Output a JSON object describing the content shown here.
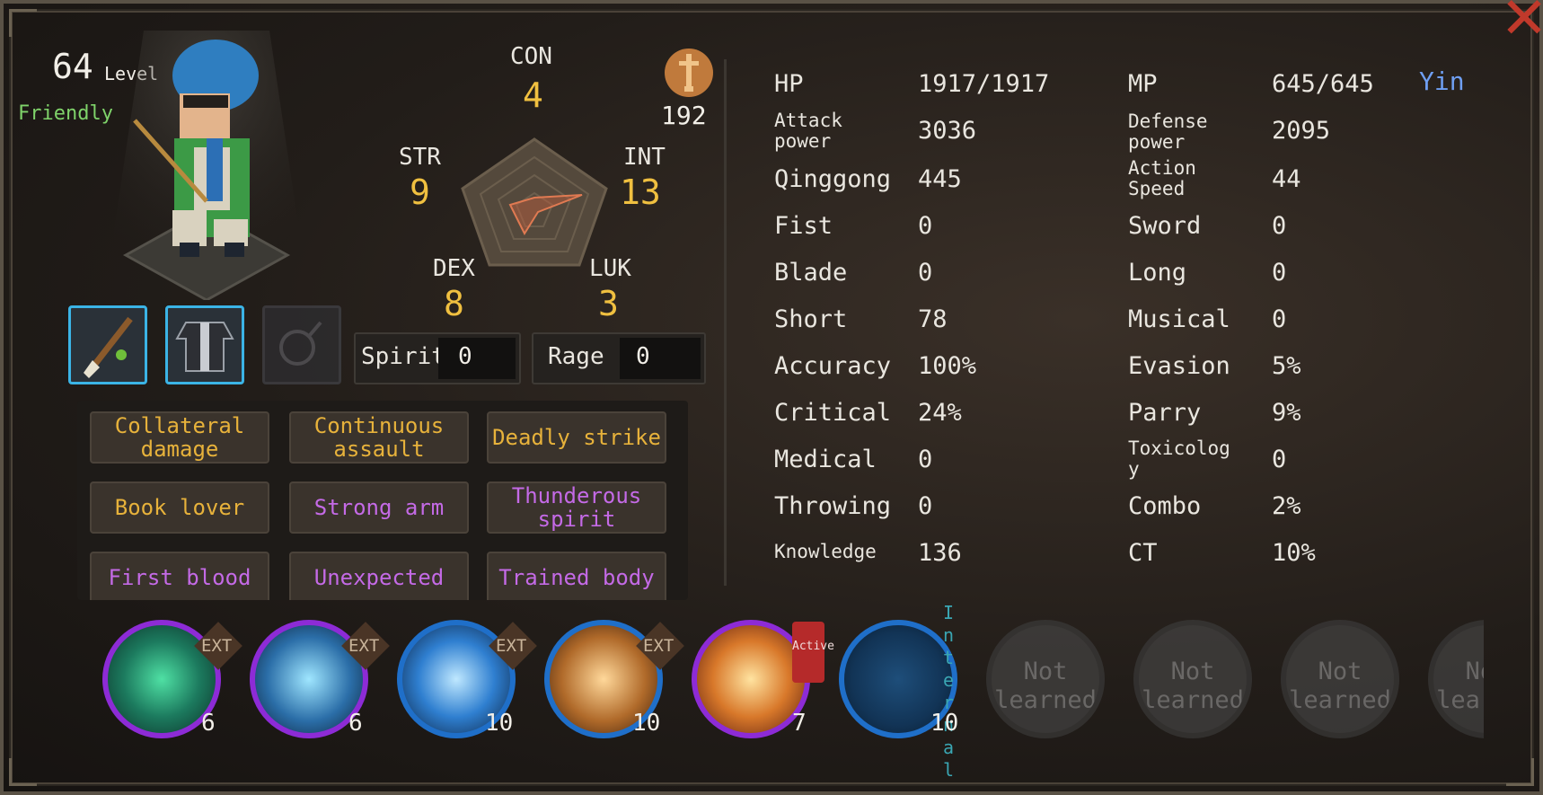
{
  "character": {
    "level": "64",
    "level_label": "Level",
    "relation": "Friendly"
  },
  "coin": {
    "value": "192",
    "icon": "sword-emblem-icon"
  },
  "stats": {
    "con": {
      "label": "CON",
      "value": 4
    },
    "str": {
      "label": "STR",
      "value": 9
    },
    "int": {
      "label": "INT",
      "value": 13
    },
    "dex": {
      "label": "DEX",
      "value": 8
    },
    "luk": {
      "label": "LUK",
      "value": 3
    }
  },
  "gauges": {
    "spirit": {
      "label": "Spirit",
      "value": "0"
    },
    "rage": {
      "label": "Rage",
      "value": "0"
    }
  },
  "equipment": [
    {
      "name": "brush-weapon-icon",
      "equipped": true
    },
    {
      "name": "robe-armor-icon",
      "equipped": true
    },
    {
      "name": "amulet-empty-icon",
      "equipped": false
    }
  ],
  "traits": [
    {
      "label": "Collateral damage",
      "color": "#e7b23b"
    },
    {
      "label": "Continuous assault",
      "color": "#e7b23b"
    },
    {
      "label": "Deadly strike",
      "color": "#e7b23b"
    },
    {
      "label": "Book lover",
      "color": "#e7b23b"
    },
    {
      "label": "Strong arm",
      "color": "#c46ae6"
    },
    {
      "label": "Thunderous spirit",
      "color": "#c46ae6"
    },
    {
      "label": "First blood",
      "color": "#c46ae6"
    },
    {
      "label": "Unexpected",
      "color": "#c46ae6"
    },
    {
      "label": "Trained body",
      "color": "#c46ae6"
    }
  ],
  "attributes_left": [
    {
      "label": "HP",
      "value": "1917/1917"
    },
    {
      "label": "Attack\npower",
      "value": "3036"
    },
    {
      "label": "Qinggong",
      "value": "445"
    },
    {
      "label": "Fist",
      "value": "0"
    },
    {
      "label": "Blade",
      "value": "0"
    },
    {
      "label": "Short",
      "value": "78"
    },
    {
      "label": "Accuracy",
      "value": "100%"
    },
    {
      "label": "Critical",
      "value": "24%"
    },
    {
      "label": "Medical",
      "value": "0"
    },
    {
      "label": "Throwing",
      "value": "0"
    },
    {
      "label": "Knowledge",
      "value": "136"
    }
  ],
  "attributes_right": [
    {
      "label": "MP",
      "value": "645/645"
    },
    {
      "label": "Defense\npower",
      "value": "2095"
    },
    {
      "label": "Action\nSpeed",
      "value": "44"
    },
    {
      "label": "Sword",
      "value": "0"
    },
    {
      "label": "Long",
      "value": "0"
    },
    {
      "label": "Musical",
      "value": "0"
    },
    {
      "label": "Evasion",
      "value": "5%"
    },
    {
      "label": "Parry",
      "value": "9%"
    },
    {
      "label": "Toxicolog\ny",
      "value": "0"
    },
    {
      "label": "Combo",
      "value": "2%"
    },
    {
      "label": "CT",
      "value": "10%"
    }
  ],
  "affinity": "Yin",
  "skills": [
    {
      "name": "wind-vortex-skill-icon",
      "level": "6",
      "tag": "EXT",
      "ring": "#8d2bd6"
    },
    {
      "name": "ice-brush-skill-icon",
      "level": "6",
      "tag": "EXT",
      "ring": "#8d2bd6"
    },
    {
      "name": "water-slash-skill-icon",
      "level": "10",
      "tag": "EXT",
      "ring": "#1f6fc9"
    },
    {
      "name": "fire-brush-skill-icon",
      "level": "10",
      "tag": "EXT",
      "ring": "#1f6fc9"
    },
    {
      "name": "demon-mask-skill-icon",
      "level": "7",
      "tag": "Active",
      "ring": "#8d2bd6"
    },
    {
      "name": "spiral-qi-skill-icon",
      "level": "10",
      "tag": "Internal",
      "ring": "#1f6fc9"
    },
    {
      "name": "not-learned-slot",
      "label": "Not learned"
    },
    {
      "name": "not-learned-slot",
      "label": "Not learned"
    },
    {
      "name": "not-learned-slot",
      "label": "Not learned"
    },
    {
      "name": "not-learned-slot",
      "label": "Not learned"
    }
  ]
}
